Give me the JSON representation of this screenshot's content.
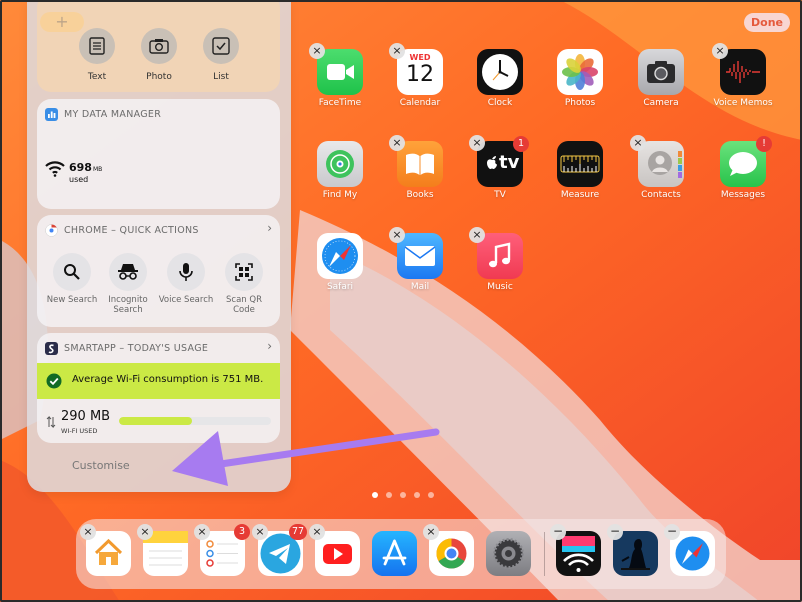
{
  "panel": {
    "add_label": "+",
    "notes_widget": {
      "actions": [
        "Text",
        "Photo",
        "List"
      ]
    },
    "data_manager": {
      "title": "MY DATA MANAGER",
      "value": "698",
      "unit": "MB",
      "sub": "used"
    },
    "chrome": {
      "title": "CHROME – QUICK ACTIONS",
      "actions": [
        {
          "label": "New Search",
          "icon": "search-icon"
        },
        {
          "label": "Incognito Search",
          "icon": "incognito-icon"
        },
        {
          "label": "Voice Search",
          "icon": "microphone-icon"
        },
        {
          "label": "Scan QR Code",
          "icon": "qr-code-icon"
        }
      ]
    },
    "smartapp": {
      "title": "SMARTAPP – TODAY'S USAGE",
      "alert": "Average Wi-Fi consumption is 751 MB.",
      "usage_value": "290 MB",
      "usage_label": "WI-FI USED",
      "progress": 0.48,
      "accent": "#cbe945"
    },
    "customise_label": "Customise"
  },
  "done_label": "Done",
  "calendar": {
    "weekday": "WED",
    "day": "12"
  },
  "apps": [
    {
      "label": "FaceTime",
      "icon": "facetime-icon"
    },
    {
      "label": "Calendar",
      "icon": "calendar-icon"
    },
    {
      "label": "Clock",
      "icon": "clock-icon"
    },
    {
      "label": "Photos",
      "icon": "photos-icon"
    },
    {
      "label": "Camera",
      "icon": "camera-icon"
    },
    {
      "label": "Voice Memos",
      "icon": "voice-memos-icon"
    },
    {
      "label": "Find My",
      "icon": "find-my-icon"
    },
    {
      "label": "Books",
      "icon": "books-icon"
    },
    {
      "label": "TV",
      "icon": "tv-icon",
      "badge": "1",
      "icon_text": "tv"
    },
    {
      "label": "Measure",
      "icon": "measure-icon"
    },
    {
      "label": "Contacts",
      "icon": "contacts-icon"
    },
    {
      "label": "Messages",
      "icon": "messages-icon",
      "badge": "!"
    },
    {
      "label": "Safari",
      "icon": "safari-icon"
    },
    {
      "label": "Mail",
      "icon": "mail-icon"
    },
    {
      "label": "Music",
      "icon": "music-icon"
    }
  ],
  "dock": [
    {
      "icon": "home-icon"
    },
    {
      "icon": "notes-icon"
    },
    {
      "icon": "reminders-icon",
      "badge": "3"
    },
    {
      "icon": "telegram-icon",
      "badge": "77"
    },
    {
      "icon": "youtube-icon"
    },
    {
      "icon": "app-store-icon"
    },
    {
      "icon": "chrome-icon"
    },
    {
      "icon": "settings-icon"
    },
    {
      "icon": "wifi-app-icon"
    },
    {
      "icon": "kindle-icon"
    },
    {
      "icon": "safari-icon"
    }
  ],
  "page_dots": {
    "count": 5,
    "active": 0
  }
}
